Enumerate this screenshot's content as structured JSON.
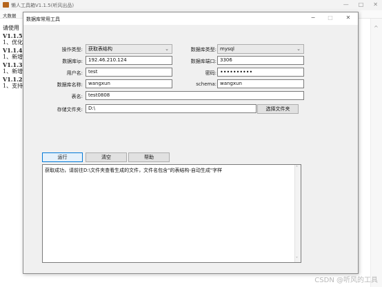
{
  "background": {
    "title": "懒人工具箱V1.1.5(听风出品)",
    "menu": "大数据",
    "text_lines": [
      {
        "text": "请使用",
        "bold": false
      },
      {
        "text": "V1.1.5",
        "bold": true
      },
      {
        "text": "1、优化",
        "bold": false
      },
      {
        "text": "V1.1.4",
        "bold": true
      },
      {
        "text": "1、新增",
        "bold": false
      },
      {
        "text": "V1.1.3",
        "bold": true
      },
      {
        "text": "1、新增",
        "bold": false
      },
      {
        "text": "V1.1.2",
        "bold": true
      },
      {
        "text": "1、支持",
        "bold": false
      }
    ],
    "minimize": "—",
    "maximize": "□",
    "close": "✕",
    "scroll_up": "^"
  },
  "dialog": {
    "title": "数据库常用工具",
    "minimize": "−",
    "maximize": "□",
    "close": "✕"
  },
  "form": {
    "operation_type_label": "操作类型:",
    "operation_type_value": "获取表结构",
    "db_type_label": "数据库类型:",
    "db_type_value": "mysql",
    "db_ip_label": "数据库ip:",
    "db_ip_value": "192.46.210.124",
    "db_port_label": "数据库端口:",
    "db_port_value": "3306",
    "username_label": "用户名:",
    "username_value": "test",
    "password_label": "密码:",
    "password_value": "••••••••••",
    "db_name_label": "数据库名称:",
    "db_name_value": "wangxun",
    "schema_label": "schema:",
    "schema_value": "wangxun",
    "table_label": "表名:",
    "table_value": "test0808",
    "folder_label": "存储文件夹:",
    "folder_value": "D:\\",
    "choose_folder_button": "选择文件夹"
  },
  "actions": {
    "run": "运行",
    "clear": "清空",
    "help": "帮助"
  },
  "output": {
    "text": "获取成功，请前往D:\\文件夹查看生成的文件，文件名包含\"的表结构-自动生成\"字样"
  },
  "watermark": "CSDN @听风的工具",
  "icons": {
    "dropdown": "chevron-down-icon",
    "app": "app-icon"
  }
}
